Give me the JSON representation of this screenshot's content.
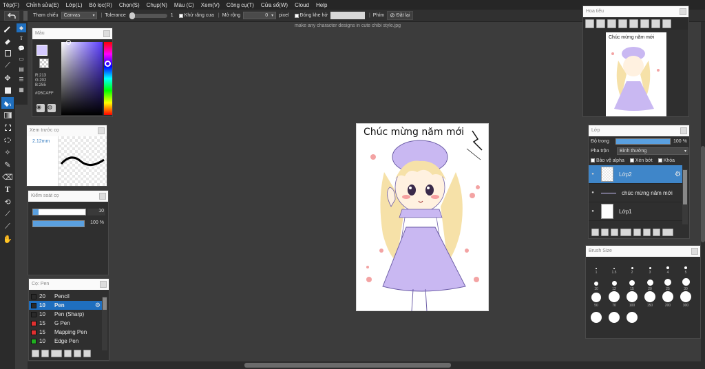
{
  "menu": [
    "Tệp(F)",
    "Chỉnh sửa(E)",
    "Lớp(L)",
    "Bộ lọc(R)",
    "Chọn(S)",
    "Chụp(N)",
    "Màu (C)",
    "Xem(V)",
    "Công cụ(T)",
    "Cửa sổ(W)",
    "Cloud",
    "Help"
  ],
  "options": {
    "ref_label": "Tham chiếu",
    "ref_value": "Canvas",
    "tolerance_label": "Tolerance",
    "tolerance_value": "1",
    "antialias_label": "Khử răng cưa",
    "expand_label": "Mở rộng",
    "expand_value": "0",
    "unit": "pixel",
    "close_gap_label": "Đóng khe hở",
    "key_label": "Phím",
    "reset_label": "Đặt lại"
  },
  "document_title": "make any character designs in cute chibi style.jpg",
  "color_panel": {
    "title": "Màu",
    "r": "R:213",
    "g": "G:202",
    "b": "B:255",
    "hex": "#D5CAFF",
    "fg_color": "#d5caff"
  },
  "brush_preview": {
    "title": "Xem trước cọ",
    "size": "2.12mm"
  },
  "brush_control": {
    "title": "Kiểm soát cọ",
    "size_value": "10",
    "opacity_value": "100 %",
    "size_fraction": 0.1,
    "opacity_fraction": 1.0
  },
  "pen_panel": {
    "title": "Cọ: Pen",
    "items": [
      {
        "num": "20",
        "name": "Pencil",
        "color": "#2a2a2a"
      },
      {
        "num": "10",
        "name": "Pen",
        "color": "#2a2a2a"
      },
      {
        "num": "10",
        "name": "Pen (Sharp)",
        "color": "#2a2a2a"
      },
      {
        "num": "15",
        "name": "G Pen",
        "color": "#e03030"
      },
      {
        "num": "15",
        "name": "Mapping Pen",
        "color": "#e03030"
      },
      {
        "num": "10",
        "name": "Edge Pen",
        "color": "#20b020"
      }
    ]
  },
  "navigator": {
    "title": "Hoa tiêu"
  },
  "artwork_text": "Chúc mừng năm mới",
  "layer_panel": {
    "title": "Lớp",
    "opacity_label": "Độ trong",
    "opacity_value": "100 %",
    "blend_label": "Pha trộn",
    "blend_value": "Bình thường",
    "protect_alpha": "Bảo vệ alpha",
    "clip": "Xén bớt",
    "lock": "Khóa",
    "layers": [
      {
        "name": "Lớp2"
      },
      {
        "name": "chúc mừng năm mới"
      },
      {
        "name": "Lớp1"
      }
    ]
  },
  "brush_size": {
    "title": "Brush Size",
    "sizes": [
      "1",
      "1.5",
      "2",
      "3",
      "4",
      "5",
      "10",
      "12",
      "15",
      "20",
      "25",
      "30",
      "50",
      "70",
      "100",
      "150",
      "200",
      "300"
    ]
  },
  "icons": [
    "undo-icon",
    "brush-icon",
    "eraser-icon",
    "move-icon",
    "fill-icon",
    "text-icon",
    "hand-icon",
    "gear-icon"
  ]
}
